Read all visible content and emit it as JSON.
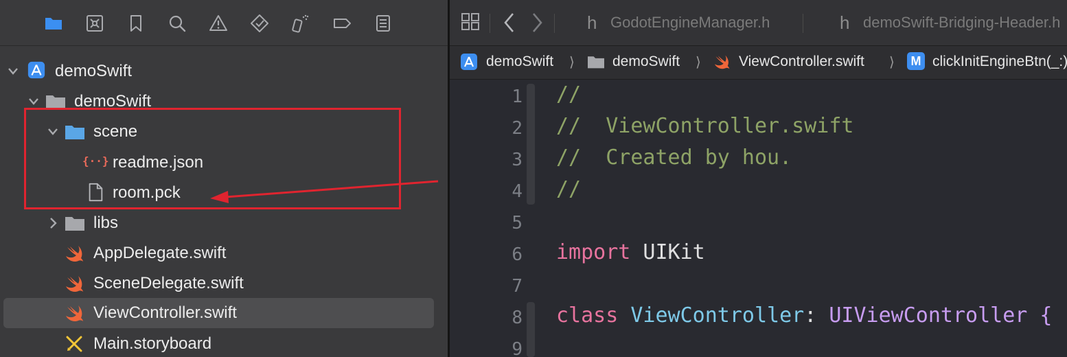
{
  "navigator": {
    "toolbar_icons": [
      "folder-icon",
      "source-control-icon",
      "bookmark-icon",
      "search-icon",
      "warning-icon",
      "test-diamond-icon",
      "debug-spray-icon",
      "breakpoint-icon",
      "report-icon"
    ],
    "tree": [
      {
        "label": "demoSwift",
        "icon": "xcode-project-icon",
        "expanded": true
      },
      {
        "label": "demoSwift",
        "icon": "folder-icon",
        "expanded": true
      },
      {
        "label": "scene",
        "icon": "folder-blue-icon",
        "expanded": true
      },
      {
        "label": "readme.json",
        "icon": "json-file-icon"
      },
      {
        "label": "room.pck",
        "icon": "file-icon"
      },
      {
        "label": "libs",
        "icon": "folder-icon",
        "expanded": false
      },
      {
        "label": "AppDelegate.swift",
        "icon": "swift-file-icon"
      },
      {
        "label": "SceneDelegate.swift",
        "icon": "swift-file-icon"
      },
      {
        "label": "ViewController.swift",
        "icon": "swift-file-icon",
        "selected": true
      },
      {
        "label": "Main.storyboard",
        "icon": "storyboard-icon"
      }
    ],
    "json_icon_text": "{··}"
  },
  "editor": {
    "tabs": [
      {
        "prefix": "h",
        "label": "GodotEngineManager.h"
      },
      {
        "prefix": "h",
        "label": "demoSwift-Bridging-Header.h"
      }
    ],
    "jumpbar": [
      {
        "label": "demoSwift",
        "icon": "xcode-project-icon"
      },
      {
        "label": "demoSwift",
        "icon": "folder-icon"
      },
      {
        "label": "ViewController.swift",
        "icon": "swift-file-icon"
      },
      {
        "label": "clickInitEngineBtn(_:)",
        "icon": "method-icon",
        "icon_text": "M"
      }
    ],
    "jumpbar_separator": "⟩",
    "line_numbers": [
      "1",
      "2",
      "3",
      "4",
      "5",
      "6",
      "7",
      "8",
      "9"
    ],
    "code": {
      "l1": "//",
      "l2": "//  ViewController.swift",
      "l3": "//  Created by hou.",
      "l4": "//",
      "l6_kw": "import",
      "l6_rest": " UIKit",
      "l8_kw": "class",
      "l8_name": " ViewController",
      "l8_colon": ":",
      "l8_super": " UIViewController {"
    }
  },
  "colors": {
    "highlight": "#e0242f",
    "comment": "#8ea366",
    "keyword": "#e7739e",
    "class_name": "#7ec9e8",
    "superclass": "#c79cf0"
  }
}
